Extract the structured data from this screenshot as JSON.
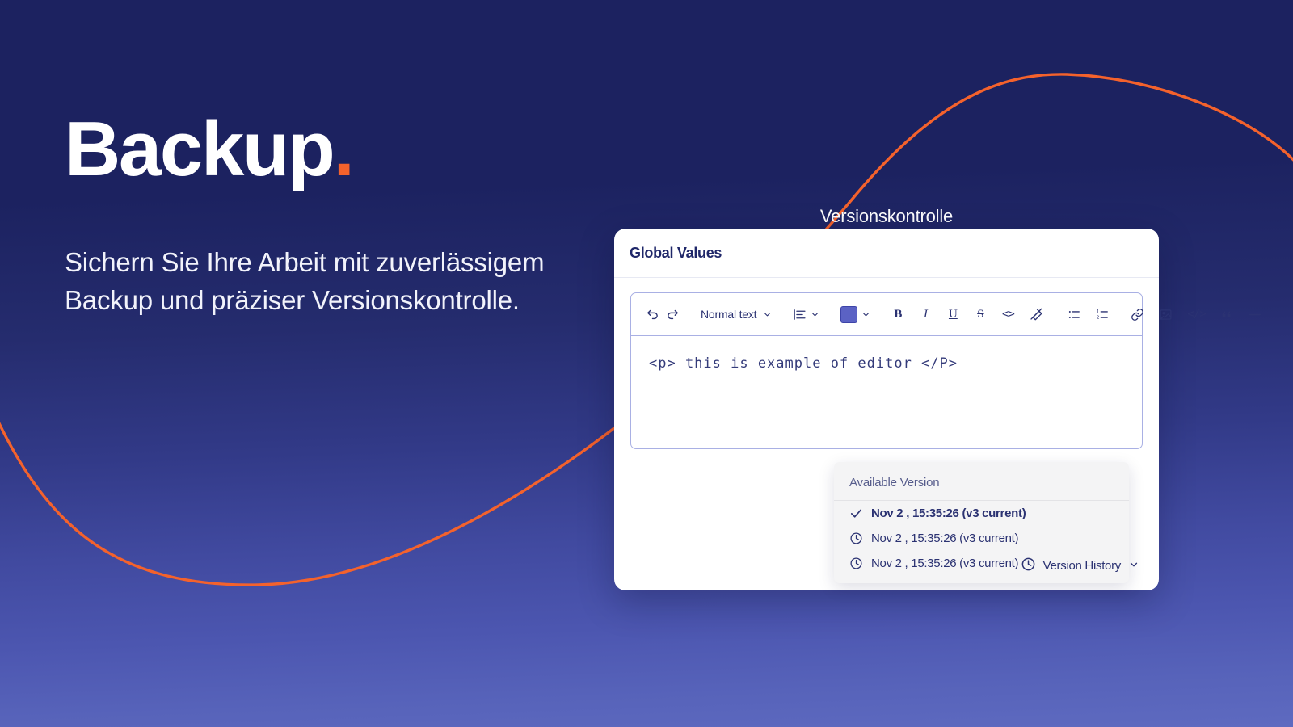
{
  "theme": {
    "bg_top": "#1c2260",
    "bg_bottom": "#5e6ac0",
    "accent_orange": "#f4622c",
    "ink": "#2b3272",
    "card_title": "#1f2769",
    "swatch": "#5b62c4",
    "toolbar_border": "#a9b0e4"
  },
  "hero": {
    "title": "Backup",
    "title_dot": ".",
    "subtitle": "Sichern Sie Ihre Arbeit mit zuverlässigem Backup und präziser Versionskontrolle."
  },
  "caption": "Versionskontrolle",
  "card": {
    "title": "Global Values",
    "toolbar": {
      "undo": "undo-icon",
      "redo": "redo-icon",
      "style_label": "Normal text",
      "align": "align-left-icon",
      "color_swatch": "#5b62c4",
      "bold": "B",
      "italic": "I",
      "underline": "U",
      "strikethrough": "S",
      "inline_code": "<>",
      "clear_format": "clear-formatting-icon",
      "bullet_list": "bulleted-list-icon",
      "numbered_list": "numbered-list-icon",
      "link": "link-icon",
      "image": "image-icon",
      "code_block": "</>",
      "quote": "quote-icon",
      "horizontal_rule": "horizontal-rule-icon"
    },
    "editor": {
      "content": "<p> this is example of editor </P>"
    },
    "version_menu": {
      "header": "Available Version",
      "items": [
        {
          "label": "Nov 2 , 15:35:26 (v3 current)",
          "icon": "check-icon",
          "current": true
        },
        {
          "label": "Nov 2 , 15:35:26 (v3 current)",
          "icon": "clock-icon",
          "current": false
        },
        {
          "label": "Nov 2 , 15:35:26 (v3 current)",
          "icon": "clock-icon",
          "current": false
        }
      ]
    },
    "footer": {
      "label": "Version History",
      "icon": "clock-icon",
      "chevron": "chevron-down-icon"
    }
  }
}
